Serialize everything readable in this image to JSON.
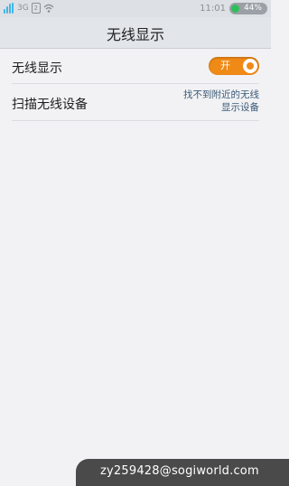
{
  "status_bar": {
    "network_type": "3G",
    "sim_label": "2",
    "time": "11:01",
    "battery": "44%",
    "icons": [
      "signal-icon",
      "sim-icon",
      "wifi-icon",
      "battery-icon"
    ],
    "signal_color": "#3fb6e6",
    "battery_color": "#2fbf5a"
  },
  "header": {
    "title": "无线显示"
  },
  "settings": {
    "wireless_display": {
      "label": "无线显示",
      "toggle_text": "开",
      "toggle_state": "on",
      "toggle_color": "#f08a16"
    },
    "scan": {
      "label": "扫描无线设备",
      "status": "找不到附近的无线显示设备"
    }
  },
  "watermark": {
    "text": "zy259428@sogiworld.com"
  }
}
